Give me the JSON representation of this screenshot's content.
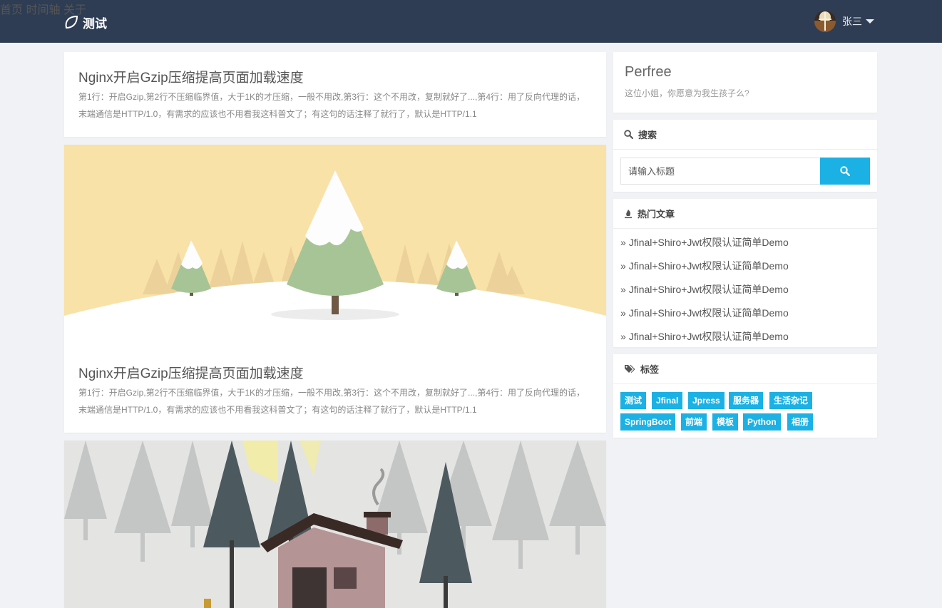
{
  "header": {
    "brand": "测试",
    "nav": [
      {
        "label": "首页"
      },
      {
        "label": "时间轴"
      },
      {
        "label": "关于"
      }
    ],
    "user": "张三"
  },
  "posts": [
    {
      "title": "Nginx开启Gzip压缩提高页面加载速度",
      "summary": "第1行：开启Gzip,第2行不压缩临界值，大于1K的才压缩，一般不用改,第3行：这个不用改，复制就好了...,第4行：用了反向代理的话，末端通信是HTTP/1.0，有需求的应该也不用看我这科普文了；有这句的话注释了就行了，默认是HTTP/1.1"
    },
    {
      "title": "Nginx开启Gzip压缩提高页面加载速度",
      "summary": "第1行：开启Gzip,第2行不压缩临界值，大于1K的才压缩，一般不用改,第3行：这个不用改，复制就好了...,第4行：用了反向代理的话，末端通信是HTTP/1.0，有需求的应该也不用看我这科普文了；有这句的话注释了就行了，默认是HTTP/1.1"
    }
  ],
  "profile": {
    "name": "Perfree",
    "motto": "这位小姐，你愿意为我生孩子么?"
  },
  "search": {
    "title": "搜索",
    "placeholder": "请输入标题"
  },
  "hot": {
    "title": "热门文章",
    "items": [
      "Jfinal+Shiro+Jwt权限认证简单Demo",
      "Jfinal+Shiro+Jwt权限认证简单Demo",
      "Jfinal+Shiro+Jwt权限认证简单Demo",
      "Jfinal+Shiro+Jwt权限认证简单Demo",
      "Jfinal+Shiro+Jwt权限认证简单Demo"
    ]
  },
  "tags": {
    "title": "标签",
    "items": [
      "测试",
      "Jfinal",
      "Jpress",
      "服务器",
      "生活杂记",
      "SpringBoot",
      "前端",
      "模板",
      "Python",
      "相册"
    ]
  },
  "colors": {
    "header_bg": "#2e3d54",
    "accent": "#1cb1e4",
    "page_bg": "#f0f2f5"
  }
}
